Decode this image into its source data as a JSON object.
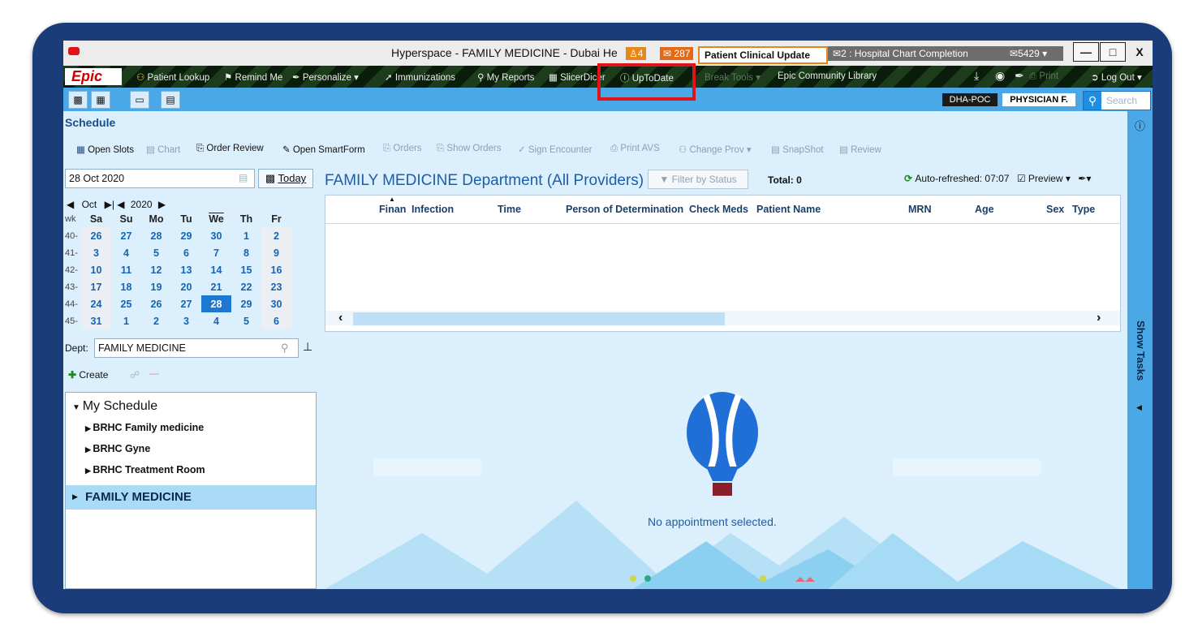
{
  "window": {
    "title": "Hyperspace - FAMILY MEDICINE - Dubai He",
    "badge_alert": "4",
    "badge_mail": "287",
    "patient_update": "Patient Clinical Update",
    "chart_completion": "2 : Hospital Chart Completion",
    "inbox_count": "5429",
    "controls": {
      "minimize": "—",
      "maximize": "□",
      "close": "X"
    }
  },
  "toolbar": {
    "logo": "Epic",
    "items": [
      "Patient Lookup",
      "Remind Me",
      "Personalize",
      "Immunizations",
      "My Reports",
      "SlicerDicer",
      "UpToDate",
      "Break Tools",
      "Epic Community Library"
    ],
    "print": "Print",
    "logout": "Log Out"
  },
  "nav": {
    "dept_tag": "DHA-POC",
    "user": "PHYSICIAN F.",
    "search_placeholder": "Search"
  },
  "schedule": {
    "title": "Schedule",
    "actions": [
      "Open Slots",
      "Chart",
      "Order Review",
      "Open SmartForm",
      "Orders",
      "Show Orders",
      "Sign Encounter",
      "Print AVS",
      "Change Prov",
      "SnapShot",
      "Review"
    ],
    "date": "28 Oct 2020",
    "today_label": "Today",
    "month": "Oct",
    "year": "2020",
    "week_label": "wk",
    "days": [
      "Sa",
      "Su",
      "Mo",
      "Tu",
      "We",
      "Th",
      "Fr"
    ],
    "weeks": [
      {
        "wk": "40-",
        "d": [
          "26",
          "27",
          "28",
          "29",
          "30",
          "1",
          "2"
        ]
      },
      {
        "wk": "41-",
        "d": [
          "3",
          "4",
          "5",
          "6",
          "7",
          "8",
          "9"
        ]
      },
      {
        "wk": "42-",
        "d": [
          "10",
          "11",
          "12",
          "13",
          "14",
          "15",
          "16"
        ]
      },
      {
        "wk": "43-",
        "d": [
          "17",
          "18",
          "19",
          "20",
          "21",
          "22",
          "23"
        ]
      },
      {
        "wk": "44-",
        "d": [
          "24",
          "25",
          "26",
          "27",
          "28",
          "29",
          "30"
        ]
      },
      {
        "wk": "45-",
        "d": [
          "31",
          "1",
          "2",
          "3",
          "4",
          "5",
          "6"
        ]
      }
    ],
    "selected_day": "28",
    "dept_label": "Dept:",
    "dept_value": "FAMILY MEDICINE",
    "create_label": "Create",
    "tree_root": "My Schedule",
    "tree_items": [
      "BRHC Family medicine",
      "BRHC Gyne",
      "BRHC Treatment Room"
    ],
    "tree_selected": "FAMILY MEDICINE"
  },
  "main": {
    "heading": "FAMILY MEDICINE Department (All Providers)",
    "filter_label": "Filter by Status",
    "total": "Total: 0",
    "auto_refresh": "Auto-refreshed: 07:07",
    "preview": "Preview",
    "columns": [
      "Finan",
      "Infection",
      "Time",
      "Person of Determination",
      "Check Meds",
      "Patient Name",
      "MRN",
      "Age",
      "Sex",
      "Type"
    ],
    "empty_message": "No appointment selected."
  },
  "side": {
    "show_tasks": "Show Tasks"
  },
  "colors": {
    "frame": "#1a3c78",
    "nav": "#4aa8e6",
    "highlight": "#e0121a",
    "accent": "#1d5ea8"
  }
}
